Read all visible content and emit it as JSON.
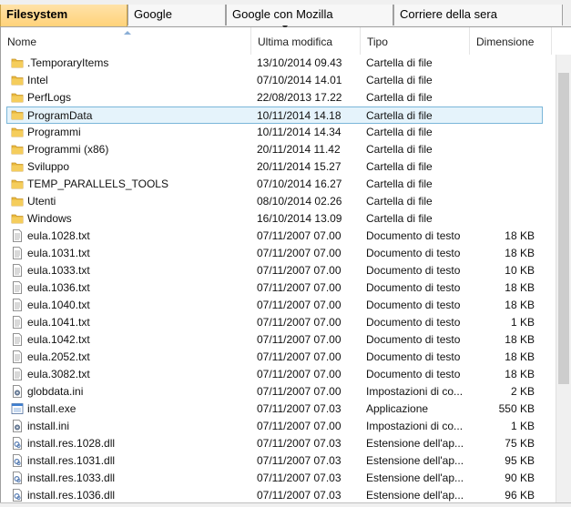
{
  "tabs": [
    {
      "label": "Filesystem",
      "active": true
    },
    {
      "label": "Google",
      "active": false
    },
    {
      "label": "Google con Mozilla",
      "active": false
    },
    {
      "label": "Corriere della sera",
      "active": false
    }
  ],
  "columns": {
    "name": "Nome",
    "modified": "Ultima modifica",
    "type": "Tipo",
    "size": "Dimensione"
  },
  "colors": {
    "folder": "#e8b83c",
    "selection_bg": "#e5f3fb",
    "selection_border": "#7ab6d9",
    "active_tab": "#ffd27a"
  },
  "files": [
    {
      "name": ".TemporaryItems",
      "modified": "13/10/2014 09.43",
      "type": "Cartella di file",
      "size": "",
      "icon": "folder-icon"
    },
    {
      "name": "Intel",
      "modified": "07/10/2014 14.01",
      "type": "Cartella di file",
      "size": "",
      "icon": "folder-icon"
    },
    {
      "name": "PerfLogs",
      "modified": "22/08/2013 17.22",
      "type": "Cartella di file",
      "size": "",
      "icon": "folder-icon"
    },
    {
      "name": "ProgramData",
      "modified": "10/11/2014 14.18",
      "type": "Cartella di file",
      "size": "",
      "icon": "folder-icon",
      "selected": true
    },
    {
      "name": "Programmi",
      "modified": "10/11/2014 14.34",
      "type": "Cartella di file",
      "size": "",
      "icon": "folder-icon"
    },
    {
      "name": "Programmi (x86)",
      "modified": "20/11/2014 11.42",
      "type": "Cartella di file",
      "size": "",
      "icon": "folder-icon"
    },
    {
      "name": "Sviluppo",
      "modified": "20/11/2014 15.27",
      "type": "Cartella di file",
      "size": "",
      "icon": "folder-icon"
    },
    {
      "name": "TEMP_PARALLELS_TOOLS",
      "modified": "07/10/2014 16.27",
      "type": "Cartella di file",
      "size": "",
      "icon": "folder-icon"
    },
    {
      "name": "Utenti",
      "modified": "08/10/2014 02.26",
      "type": "Cartella di file",
      "size": "",
      "icon": "folder-icon"
    },
    {
      "name": "Windows",
      "modified": "16/10/2014 13.09",
      "type": "Cartella di file",
      "size": "",
      "icon": "folder-icon"
    },
    {
      "name": "eula.1028.txt",
      "modified": "07/11/2007 07.00",
      "type": "Documento di testo",
      "size": "18 KB",
      "icon": "text-file-icon"
    },
    {
      "name": "eula.1031.txt",
      "modified": "07/11/2007 07.00",
      "type": "Documento di testo",
      "size": "18 KB",
      "icon": "text-file-icon"
    },
    {
      "name": "eula.1033.txt",
      "modified": "07/11/2007 07.00",
      "type": "Documento di testo",
      "size": "10 KB",
      "icon": "text-file-icon"
    },
    {
      "name": "eula.1036.txt",
      "modified": "07/11/2007 07.00",
      "type": "Documento di testo",
      "size": "18 KB",
      "icon": "text-file-icon"
    },
    {
      "name": "eula.1040.txt",
      "modified": "07/11/2007 07.00",
      "type": "Documento di testo",
      "size": "18 KB",
      "icon": "text-file-icon"
    },
    {
      "name": "eula.1041.txt",
      "modified": "07/11/2007 07.00",
      "type": "Documento di testo",
      "size": "1 KB",
      "icon": "text-file-icon"
    },
    {
      "name": "eula.1042.txt",
      "modified": "07/11/2007 07.00",
      "type": "Documento di testo",
      "size": "18 KB",
      "icon": "text-file-icon"
    },
    {
      "name": "eula.2052.txt",
      "modified": "07/11/2007 07.00",
      "type": "Documento di testo",
      "size": "18 KB",
      "icon": "text-file-icon"
    },
    {
      "name": "eula.3082.txt",
      "modified": "07/11/2007 07.00",
      "type": "Documento di testo",
      "size": "18 KB",
      "icon": "text-file-icon"
    },
    {
      "name": "globdata.ini",
      "modified": "07/11/2007 07.00",
      "type": "Impostazioni di co...",
      "size": "2 KB",
      "icon": "settings-file-icon"
    },
    {
      "name": "install.exe",
      "modified": "07/11/2007 07.03",
      "type": "Applicazione",
      "size": "550 KB",
      "icon": "application-icon"
    },
    {
      "name": "install.ini",
      "modified": "07/11/2007 07.00",
      "type": "Impostazioni di co...",
      "size": "1 KB",
      "icon": "settings-file-icon"
    },
    {
      "name": "install.res.1028.dll",
      "modified": "07/11/2007 07.03",
      "type": "Estensione dell'ap...",
      "size": "75 KB",
      "icon": "dll-file-icon"
    },
    {
      "name": "install.res.1031.dll",
      "modified": "07/11/2007 07.03",
      "type": "Estensione dell'ap...",
      "size": "95 KB",
      "icon": "dll-file-icon"
    },
    {
      "name": "install.res.1033.dll",
      "modified": "07/11/2007 07.03",
      "type": "Estensione dell'ap...",
      "size": "90 KB",
      "icon": "dll-file-icon"
    },
    {
      "name": "install.res.1036.dll",
      "modified": "07/11/2007 07.03",
      "type": "Estensione dell'ap...",
      "size": "96 KB",
      "icon": "dll-file-icon"
    }
  ]
}
